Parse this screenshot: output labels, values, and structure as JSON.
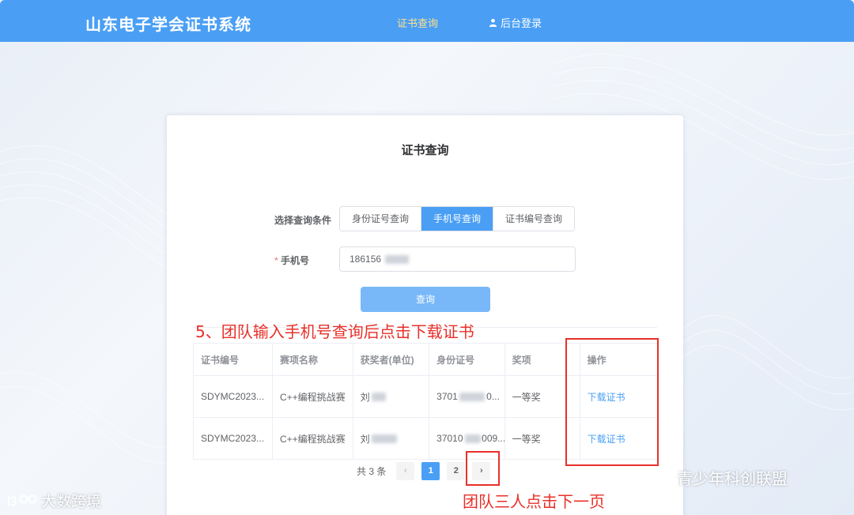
{
  "header": {
    "site_title": "山东电子学会证书系统",
    "nav_cert_query": "证书查询",
    "nav_admin_login": "后台登录"
  },
  "card": {
    "title": "证书查询",
    "condition_label": "选择查询条件",
    "condition_options": [
      "身份证号查询",
      "手机号查询",
      "证书编号查询"
    ],
    "selected_condition": "手机号查询",
    "required_mark": "*",
    "phone_label": "手机号",
    "phone_value": "186156",
    "query_button": "查询"
  },
  "table": {
    "headers": [
      "证书编号",
      "赛项名称",
      "获奖者(单位)",
      "身份证号",
      "奖项",
      "操作"
    ],
    "rows": [
      {
        "cert_no": "SDYMC2023...",
        "event": "C++编程挑战赛",
        "winner": "刘",
        "id_no": "3701",
        "id_tail": "0...",
        "award": "一等奖",
        "action": "下载证书"
      },
      {
        "cert_no": "SDYMC2023...",
        "event": "C++编程挑战赛",
        "winner": "刘",
        "id_no": "37010",
        "id_tail": "009...",
        "award": "一等奖",
        "action": "下载证书"
      }
    ]
  },
  "pagination": {
    "total_text": "共 3 条",
    "prev": "‹",
    "pages": [
      "1",
      "2"
    ],
    "current_page": "1",
    "next": "›"
  },
  "annotations": {
    "step5": "5、团队输入手机号查询后点击下载证书",
    "next_page": "团队三人点击下一页"
  },
  "watermarks": {
    "left": "大数跨境",
    "right": "青少年科创联盟"
  },
  "colors": {
    "header_bg": "#4a9ff5",
    "accent": "#4a9ff5",
    "annotation_red": "#e8302a",
    "nav_active": "#ffe08a"
  },
  "icons": {
    "admin_login": "user-icon",
    "wechat_watermark": "wechat-icon",
    "left_watermark": "brand-logo"
  }
}
